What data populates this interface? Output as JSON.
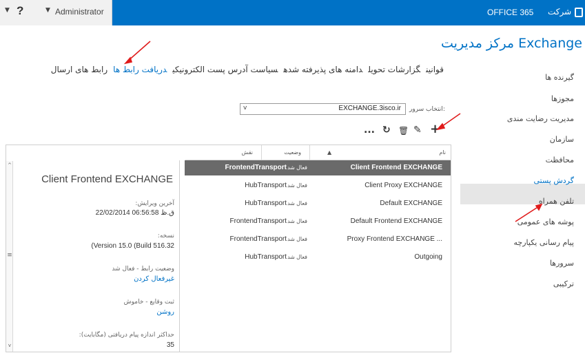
{
  "topbar": {
    "help": "?",
    "user": "Administrator",
    "office": "OFFICE 365",
    "company": "شرکت"
  },
  "app_title": "مرکز مدیریت Exchange",
  "sidebar": {
    "items": [
      {
        "label": "گیرنده ها"
      },
      {
        "label": "مجوزها"
      },
      {
        "label": "مدیریت رضایت مندی"
      },
      {
        "label": "سازمان"
      },
      {
        "label": "محافظت"
      },
      {
        "label": "گردش پستی",
        "active": true
      },
      {
        "label": "تلفن همراه"
      },
      {
        "label": "پوشه های عمومی"
      },
      {
        "label": "پیام رسانی یکپارچه"
      },
      {
        "label": "سرورها"
      },
      {
        "label": "ترکیبی"
      }
    ]
  },
  "tabs": [
    {
      "label": "قوانین"
    },
    {
      "label": "گزارشات تحویل"
    },
    {
      "label": "دامنه های پذیرفته شده"
    },
    {
      "label": "سیاست آدرس پست الکترونیکی"
    },
    {
      "label": "دریافت رابط ها",
      "active": true
    },
    {
      "label": "رابط های ارسال"
    }
  ],
  "server": {
    "label": "انتخاب سرور:",
    "value": "EXCHANGE.3isco.ir"
  },
  "toolbar": {
    "add": "+",
    "edit": "✎",
    "delete": "🗑",
    "refresh": "↻",
    "more": "..."
  },
  "table": {
    "headers": {
      "name": "نام",
      "status": "وضعیت",
      "role": "نقش"
    },
    "rows": [
      {
        "name": "Client Frontend EXCHANGE",
        "status": "فعال شد",
        "role": "FrontendTransport",
        "selected": true
      },
      {
        "name": "Client Proxy EXCHANGE",
        "status": "فعال شد",
        "role": "HubTransport"
      },
      {
        "name": "Default EXCHANGE",
        "status": "فعال شد",
        "role": "HubTransport"
      },
      {
        "name": "Default Frontend EXCHANGE",
        "status": "فعال شد",
        "role": "FrontendTransport"
      },
      {
        "name": "Proxy Frontend EXCHANGE ...",
        "status": "فعال شد",
        "role": "FrontendTransport"
      },
      {
        "name": "Outgoing",
        "status": "فعال شد",
        "role": "HubTransport"
      }
    ]
  },
  "details": {
    "title": "Client Frontend EXCHANGE",
    "last_modified_label": "آخرین ویرایش:",
    "last_modified_value": "22/02/2014 06:56:58 ق.ظ",
    "version_label": "نسخه:",
    "version_value": "(Version 15.0 (Build 516.32",
    "connector_status": "وضعیت رابط - فعال شد",
    "disable_link": "غیرفعال کردن",
    "logging": "ثبت وقایع - خاموش",
    "enable_link": "روشن",
    "max_size_label": "حداکثر اندازه پیام دریافتی (مگابایت):",
    "max_size_value": "35"
  },
  "scrollbar": {
    "up": "^",
    "mid": "≡",
    "down": "v"
  }
}
